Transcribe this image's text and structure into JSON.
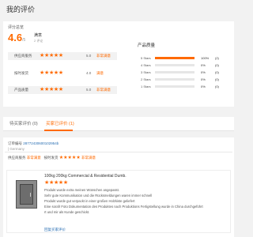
{
  "header": {
    "title": "我的评价"
  },
  "summary": {
    "label": "评分总览",
    "score": "4.6",
    "score_suffix": "/5",
    "satisfaction": "满意",
    "count": "2 评论",
    "details": [
      {
        "label": "供应商服务",
        "stars": "★★★★★",
        "score": "5.0",
        "tag": "非常满意"
      },
      {
        "label": "按时发货",
        "stars": "★★★★★",
        "score": "4.0",
        "tag": "满意"
      },
      {
        "label": "产品质量",
        "stars": "★★★★★",
        "score": "5.0",
        "tag": "非常满意"
      }
    ]
  },
  "quality": {
    "title": "产品质量",
    "rows": [
      {
        "label": "5 Stars",
        "pct": "100%",
        "pct_value": 100,
        "count": "(2)"
      },
      {
        "label": "4 Stars",
        "pct": "0%",
        "pct_value": 0,
        "count": "(0)"
      },
      {
        "label": "3 Stars",
        "pct": "0%",
        "pct_value": 0,
        "count": "(0)"
      },
      {
        "label": "2 Stars",
        "pct": "0%",
        "pct_value": 0,
        "count": "(0)"
      },
      {
        "label": "1 Stars",
        "pct": "0%",
        "pct_value": 0,
        "count": "(0)"
      }
    ]
  },
  "tabs": [
    {
      "label": "待买家评价 (0)",
      "active": false
    },
    {
      "label": "买家已评价 (1)",
      "active": true
    }
  ],
  "order": {
    "number_label": "订单编号",
    "number": "28772430600102954b",
    "seller": "| Germany",
    "detail_line": {
      "label1": "供应商服务",
      "tag1": "非常满意",
      "label2": "按时发货",
      "tag2": "非常满意"
    },
    "stars": "★★★★★",
    "product": {
      "title": "100kg 200kg Commercial & Residential Dumb.",
      "stars": "★★★★★",
      "review_lines": [
        "Produkt wurde extra meinen Wünschen angepasst.",
        "Sehr gute Kommunikation und die Rücksmeldungen waren immer schnell",
        "Produkt wurde gut verpackt in einer großen Holzkiste geliefert",
        "Eine sorafr Foto Dokumentation des Produktes nach Produktions Fertigstellung wurde  in China durchgeführt",
        "rt und mir als Kunde geschickt."
      ],
      "reply_label": "回复买家评价"
    }
  }
}
